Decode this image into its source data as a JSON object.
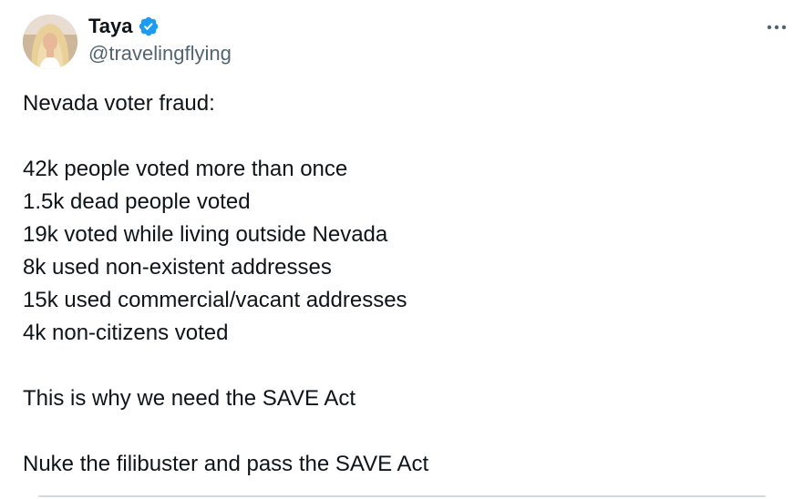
{
  "tweet": {
    "author": {
      "display_name": "Taya",
      "handle": "@travelingflying",
      "verified": true,
      "verified_icon": "verified-badge-icon",
      "verified_color": "#1d9bf0"
    },
    "more_icon": "more-horizontal-icon",
    "lines": [
      "Nevada voter fraud:",
      "",
      "42k people voted more than once",
      "1.5k dead people voted",
      "19k voted while living outside Nevada",
      "8k used non-existent addresses",
      "15k used commercial/vacant addresses",
      "4k non-citizens voted",
      "",
      "This is why we need the SAVE Act",
      "",
      "Nuke the filibuster and pass the SAVE Act"
    ]
  },
  "colors": {
    "text_primary": "#0f1419",
    "text_secondary": "#536471",
    "divider": "#cfd9de",
    "accent": "#1d9bf0"
  }
}
